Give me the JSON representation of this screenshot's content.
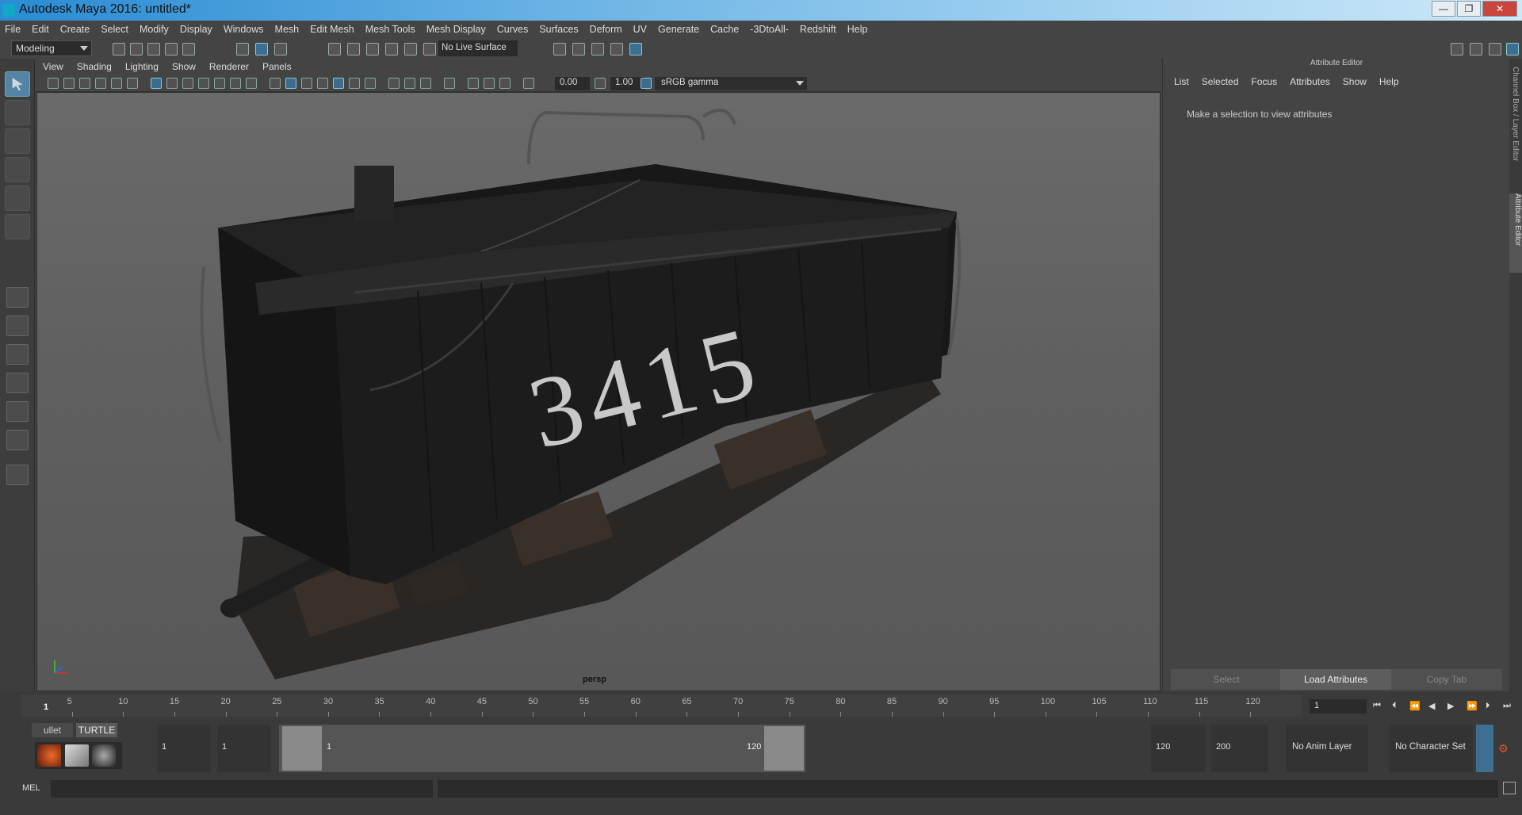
{
  "window": {
    "title": "Autodesk Maya 2016: untitled*",
    "minimize": "—",
    "restore": "❐",
    "close": "✕"
  },
  "menubar": [
    "File",
    "Edit",
    "Create",
    "Select",
    "Modify",
    "Display",
    "Windows",
    "Mesh",
    "Edit Mesh",
    "Mesh Tools",
    "Mesh Display",
    "Curves",
    "Surfaces",
    "Deform",
    "UV",
    "Generate",
    "Cache",
    "-3DtoAll-",
    "Redshift",
    "Help"
  ],
  "shelf": {
    "mode": "Modeling",
    "live_surface": "No Live Surface"
  },
  "viewport": {
    "menu": [
      "View",
      "Shading",
      "Lighting",
      "Show",
      "Renderer",
      "Panels"
    ],
    "near_value": "0.00",
    "gamma_value": "1.00",
    "color_space": "sRGB gamma",
    "camera_label": "persp",
    "car_number": "3415"
  },
  "attribute_editor": {
    "title": "Attribute Editor",
    "menu": [
      "List",
      "Selected",
      "Focus",
      "Attributes",
      "Show",
      "Help"
    ],
    "message": "Make a selection to view attributes",
    "buttons": {
      "select": "Select",
      "load": "Load Attributes",
      "copy": "Copy Tab"
    },
    "side_tab_1": "Channel Box / Layer Editor",
    "side_tab_2": "Attribute Editor"
  },
  "timeline": {
    "ticks": [
      "5",
      "10",
      "15",
      "20",
      "25",
      "30",
      "35",
      "40",
      "45",
      "50",
      "55",
      "60",
      "65",
      "70",
      "75",
      "80",
      "85",
      "90",
      "95",
      "100",
      "105",
      "110",
      "115",
      "120"
    ],
    "current_frame_label": "1",
    "current_frame": "1"
  },
  "range": {
    "shelf_tabs": [
      "ullet",
      "TURTLE"
    ],
    "start": "1",
    "playback_start": "1",
    "slider_start": "1",
    "slider_end": "120",
    "playback_end": "120",
    "end": "200",
    "anim_layer": "No Anim Layer",
    "char_set": "No Character Set"
  },
  "mel": {
    "label": "MEL"
  }
}
